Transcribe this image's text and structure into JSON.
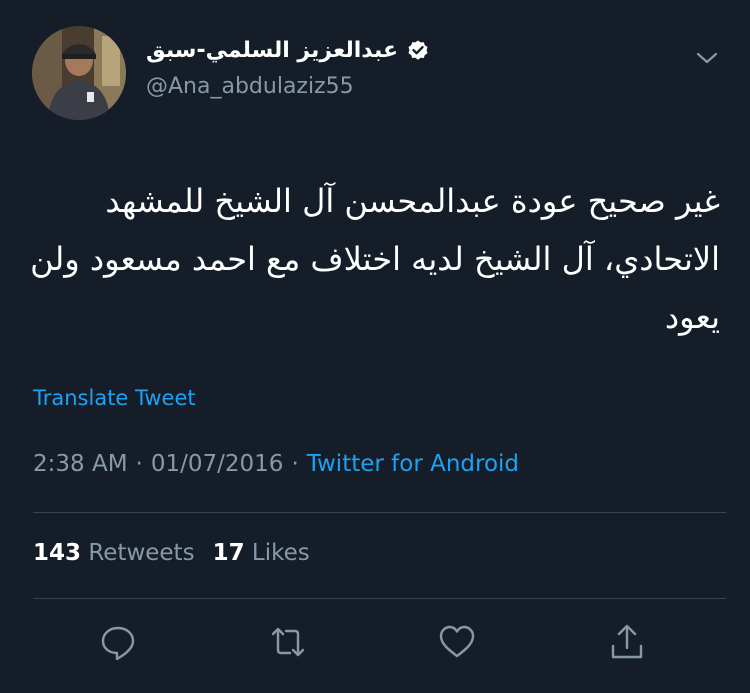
{
  "author": {
    "display_name": "عبدالعزيز السلمي-سبق",
    "handle": "@Ana_abdulaziz55",
    "verified": true
  },
  "tweet": {
    "text": "غير صحيح عودة عبدالمحسن آل الشيخ للمشهد الاتحادي، آل الشيخ لديه اختلاف مع احمد مسعود ولن يعود",
    "translate_label": "Translate Tweet",
    "time": "2:38 AM",
    "date": "01/07/2016",
    "separator": "·",
    "source": "Twitter for Android"
  },
  "stats": {
    "retweets_count": "143",
    "retweets_label": "Retweets",
    "likes_count": "17",
    "likes_label": "Likes"
  },
  "icons": {
    "reply": "reply-icon",
    "retweet": "retweet-icon",
    "like": "heart-icon",
    "share": "share-icon",
    "menu": "chevron-down-icon",
    "verified": "verified-badge-icon"
  },
  "colors": {
    "background": "#151e28",
    "accent": "#1da1f2",
    "secondary_text": "#8899a6",
    "divider": "#38444d"
  }
}
